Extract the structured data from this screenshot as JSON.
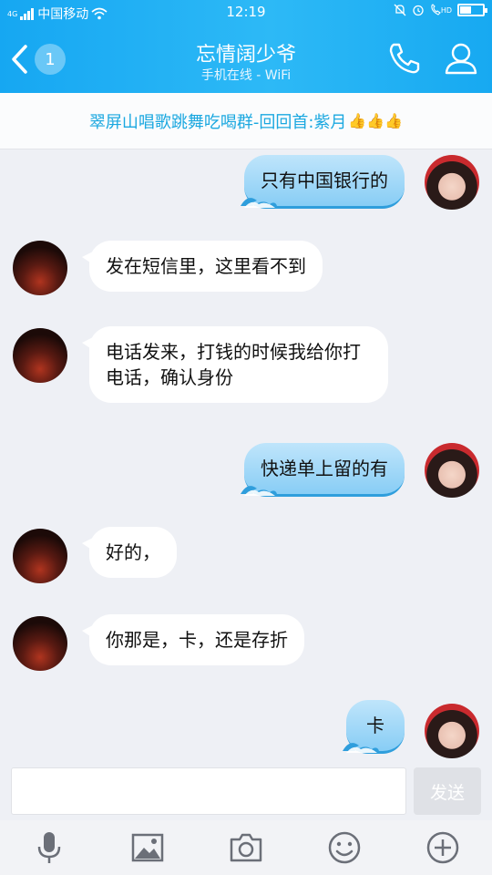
{
  "status_bar": {
    "network_badge": "4G",
    "carrier": "中国移动",
    "time": "12:19",
    "hd_label": "HD"
  },
  "header": {
    "back_badge": "1",
    "title": "忘情阔少爷",
    "subtitle": "手机在线 - WiFi"
  },
  "banner": {
    "text": "翠屏山唱歌跳舞吃喝群-回回首:紫月",
    "emoji": "👍👍👍"
  },
  "messages": [
    {
      "side": "out",
      "text": "只有中国银行的"
    },
    {
      "side": "in",
      "text": "发在短信里，这里看不到"
    },
    {
      "side": "in",
      "text": "电话发来，打钱的时候我给你打电话，确认身份"
    },
    {
      "side": "out",
      "text": "快递单上留的有"
    },
    {
      "side": "in",
      "text": "好的，"
    },
    {
      "side": "in",
      "text": "你那是，卡，还是存折"
    },
    {
      "side": "out",
      "text": "卡"
    }
  ],
  "input": {
    "value": "",
    "placeholder": "",
    "send_label": "发送"
  },
  "toolbar": {
    "icons": [
      "microphone-icon",
      "image-icon",
      "camera-icon",
      "emoji-icon",
      "plus-icon"
    ]
  },
  "colors": {
    "header": "#1fb0f4",
    "banner_text": "#1ba8e0",
    "bubble_out": "#a5d9f8",
    "bubble_in": "#ffffff"
  }
}
